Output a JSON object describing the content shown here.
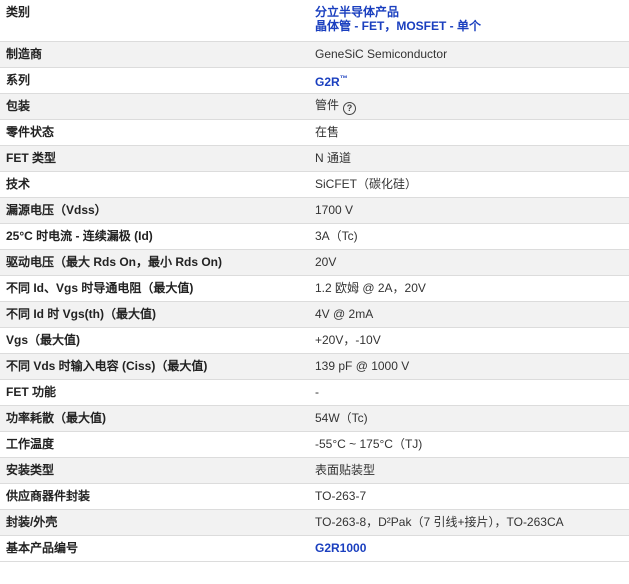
{
  "rows": [
    {
      "label": "类别",
      "value_lines": [
        "分立半导体产品",
        "晶体管 - FET，MOSFET - 单个"
      ]
    },
    {
      "label": "制造商",
      "value": "GeneSiC Semiconductor"
    },
    {
      "label": "系列",
      "value": "G2R",
      "value_suffix": "™"
    },
    {
      "label": "包装",
      "value": "管件"
    },
    {
      "label": "零件状态",
      "value": "在售"
    },
    {
      "label": "FET 类型",
      "value": "N 通道"
    },
    {
      "label": "技术",
      "value": "SiCFET（碳化硅）"
    },
    {
      "label": "漏源电压（Vdss）",
      "value": "1700 V"
    },
    {
      "label": "25°C 时电流 - 连续漏极 (Id)",
      "value": "3A（Tc)"
    },
    {
      "label": "驱动电压（最大 Rds On，最小 Rds On)",
      "value": "20V"
    },
    {
      "label": "不同 Id、Vgs 时导通电阻（最大值)",
      "value": "1.2 欧姆 @ 2A，20V"
    },
    {
      "label": "不同 Id 时 Vgs(th)（最大值)",
      "value": "4V @ 2mA"
    },
    {
      "label": "Vgs（最大值)",
      "value": "+20V，-10V"
    },
    {
      "label": "不同 Vds 时输入电容 (Ciss)（最大值)",
      "value": "139 pF @ 1000 V"
    },
    {
      "label": "FET 功能",
      "value": "-"
    },
    {
      "label": "功率耗散（最大值)",
      "value": "54W（Tc)"
    },
    {
      "label": "工作温度",
      "value": "-55°C ~ 175°C（TJ)"
    },
    {
      "label": "安装类型",
      "value": "表面贴装型"
    },
    {
      "label": "供应商器件封装",
      "value": "TO-263-7"
    },
    {
      "label": "封装/外壳",
      "value": "TO-263-8，D²Pak（7 引线+接片），TO-263CA"
    },
    {
      "label": "基本产品编号",
      "value": "G2R1000"
    }
  ],
  "help_icon_glyph": "?",
  "colors": {
    "link": "#1a3fbf",
    "alt_row": "#f2f2f2",
    "border": "#dcdcdc"
  }
}
